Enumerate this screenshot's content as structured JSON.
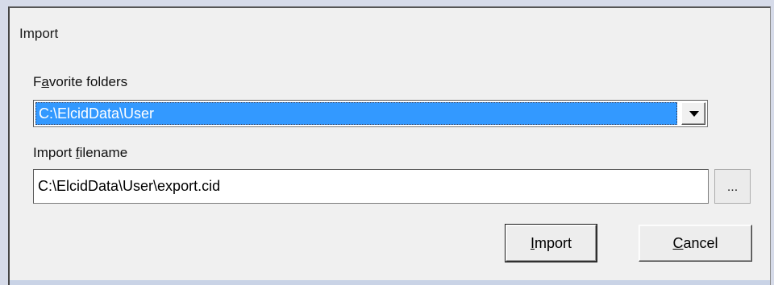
{
  "dialog": {
    "title": "Import"
  },
  "favorite_folders": {
    "label_prefix": "F",
    "label_mnemonic": "a",
    "label_rest": "vorite folders",
    "selected_value": "C:\\ElcidData\\User",
    "dropdown_icon": "chevron-down-icon"
  },
  "import_filename": {
    "label_prefix": "Import ",
    "label_mnemonic": "f",
    "label_rest": "ilename",
    "value": "C:\\ElcidData\\User\\export.cid",
    "browse_label": "..."
  },
  "buttons": {
    "import_mnemonic": "I",
    "import_rest": "mport",
    "cancel_mnemonic": "C",
    "cancel_rest": "ancel"
  },
  "colors": {
    "selection": "#3399ff",
    "dialog_background": "#f0f0f0",
    "window_background": "#d6dbe9"
  }
}
